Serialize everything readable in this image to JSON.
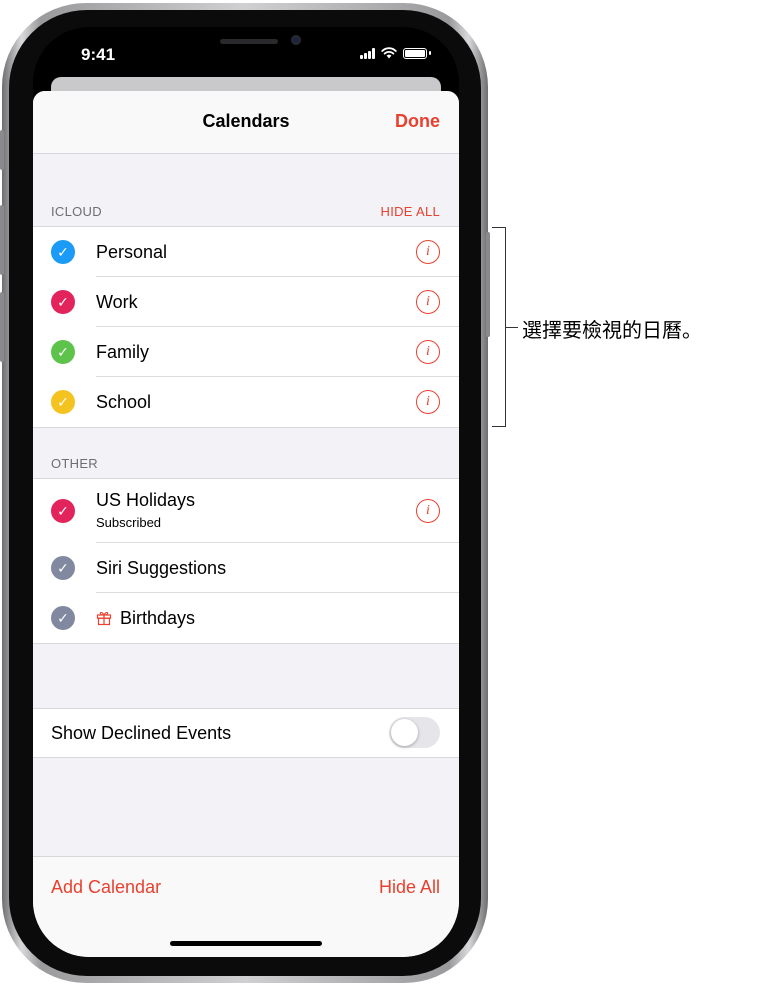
{
  "status_bar": {
    "time": "9:41",
    "signal_icon": "cellular-signal-icon",
    "wifi_icon": "wifi-icon",
    "battery_icon": "battery-icon"
  },
  "nav": {
    "title": "Calendars",
    "done_label": "Done"
  },
  "icloud_section": {
    "header": "ICLOUD",
    "hide_all_label": "HIDE ALL",
    "items": [
      {
        "label": "Personal",
        "color": "#1b9af7"
      },
      {
        "label": "Work",
        "color": "#e2235c"
      },
      {
        "label": "Family",
        "color": "#5dc34a"
      },
      {
        "label": "School",
        "color": "#f5c320"
      }
    ]
  },
  "other_section": {
    "header": "OTHER",
    "items": [
      {
        "label": "US Holidays",
        "subtitle": "Subscribed",
        "color": "#e2235c"
      },
      {
        "label": "Siri Suggestions",
        "color": "#8189a0"
      },
      {
        "label": "Birthdays",
        "color": "#8189a0",
        "icon": "gift-icon"
      }
    ]
  },
  "settings": {
    "show_declined_label": "Show Declined Events",
    "show_declined_on": false
  },
  "footer": {
    "add_calendar_label": "Add Calendar",
    "hide_all_label": "Hide All"
  },
  "colors": {
    "accent": "#e8412f"
  },
  "callout": {
    "text": "選擇要檢視的日曆。"
  }
}
